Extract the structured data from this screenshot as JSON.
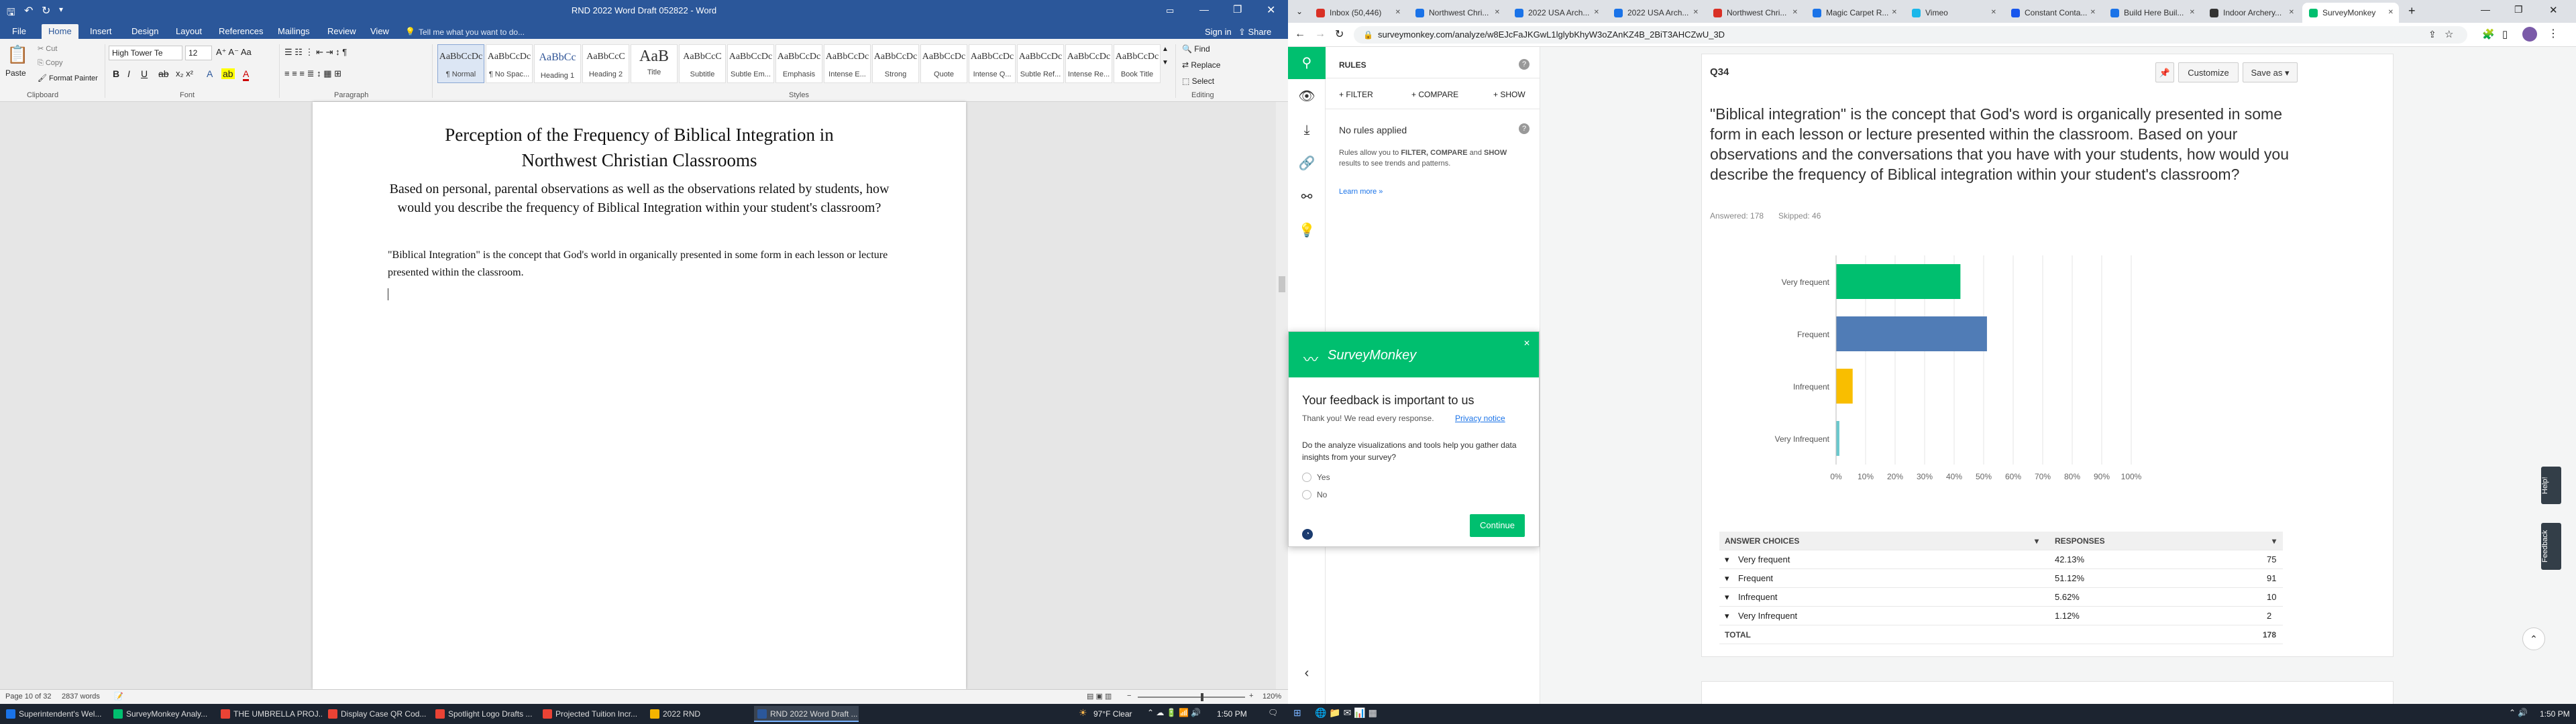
{
  "word": {
    "title": "RND 2022 Word Draft 052822 - Word",
    "signin": "Sign in",
    "share": "Share",
    "tabs": [
      "File",
      "Home",
      "Insert",
      "Design",
      "Layout",
      "References",
      "Mailings",
      "Review",
      "View"
    ],
    "tellme": "Tell me what you want to do...",
    "clipboard": {
      "paste": "Paste",
      "cut": "Cut",
      "copy": "Copy",
      "format_painter": "Format Painter",
      "label": "Clipboard"
    },
    "font": {
      "family": "High Tower Te",
      "size": "12",
      "label": "Font"
    },
    "paragraph_label": "Paragraph",
    "styles": [
      {
        "preview": "AaBbCcDc",
        "name": "¶ Normal"
      },
      {
        "preview": "AaBbCcDc",
        "name": "¶ No Spac..."
      },
      {
        "preview": "AaBbCc",
        "name": "Heading 1"
      },
      {
        "preview": "AaBbCcC",
        "name": "Heading 2"
      },
      {
        "preview": "AaB",
        "name": "Title"
      },
      {
        "preview": "AaBbCcC",
        "name": "Subtitle"
      },
      {
        "preview": "AaBbCcDc",
        "name": "Subtle Em..."
      },
      {
        "preview": "AaBbCcDc",
        "name": "Emphasis"
      },
      {
        "preview": "AaBbCcDc",
        "name": "Intense E..."
      },
      {
        "preview": "AaBbCcDc",
        "name": "Strong"
      },
      {
        "preview": "AaBbCcDc",
        "name": "Quote"
      },
      {
        "preview": "AaBbCcDc",
        "name": "Intense Q..."
      },
      {
        "preview": "AaBbCcDc",
        "name": "Subtle Ref..."
      },
      {
        "preview": "AaBbCcDc",
        "name": "Intense Re..."
      },
      {
        "preview": "AaBbCcDc",
        "name": "Book Title"
      }
    ],
    "styles_label": "Styles",
    "editing": {
      "find": "Find",
      "replace": "Replace",
      "select": "Select",
      "label": "Editing"
    },
    "doc": {
      "title_line1": "Perception of the Frequency of Biblical Integration in",
      "title_line2": "Northwest Christian Classrooms",
      "subtitle": "Based on personal, parental observations as well as the observations related by students, how would you describe the frequency of Biblical Integration within your student's classroom?",
      "body": "\"Biblical Integration\" is the concept that God's world in organically presented in some form in each lesson or lecture presented within the classroom."
    },
    "status": {
      "page": "Page 10 of 32",
      "words": "2837 words",
      "zoom": "120%"
    }
  },
  "chrome": {
    "tabs": [
      {
        "title": "Inbox (50,446)",
        "color": "#d93025"
      },
      {
        "title": "Northwest Chri...",
        "color": "#1a73e8"
      },
      {
        "title": "2022 USA Arch...",
        "color": "#1a73e8"
      },
      {
        "title": "2022 USA Arch...",
        "color": "#1a73e8"
      },
      {
        "title": "Northwest Chri...",
        "color": "#d93025"
      },
      {
        "title": "Magic Carpet R...",
        "color": "#1a73e8"
      },
      {
        "title": "Vimeo",
        "color": "#1ab7ea"
      },
      {
        "title": "Constant Conta...",
        "color": "#1856ed"
      },
      {
        "title": "Build Here Buil...",
        "color": "#1a73e8"
      },
      {
        "title": "Indoor Archery...",
        "color": "#333333"
      },
      {
        "title": "SurveyMonkey",
        "color": "#00bf6f"
      }
    ],
    "url": "surveymonkey.com/analyze/w8EJcFaJKGwL1lglybKhyW3oZAnKZ4B_2BiT3AHCZwU_3D"
  },
  "survey": {
    "rules": {
      "header": "RULES",
      "filter": "+ FILTER",
      "compare": "+ COMPARE",
      "show": "+ SHOW",
      "none": "No rules applied",
      "desc_a": "Rules allow you to ",
      "desc_b": "FILTER, COMPARE",
      "desc_c": " and ",
      "desc_d": "SHOW",
      "desc_e": " results to see trends and patterns.",
      "learn": "Learn more »"
    },
    "question": {
      "id": "Q34",
      "text": "\"Biblical integration\" is the concept that God's word is organically presented in some form in each lesson or lecture presented within the classroom. Based on your observations and the conversations that you have with your students, how would you describe the frequency of Biblical integration within your student's classroom?",
      "answered": "Answered: 178",
      "skipped": "Skipped: 46",
      "customize": "Customize",
      "save_as": "Save as"
    },
    "table": {
      "headers": [
        "ANSWER CHOICES",
        "RESPONSES"
      ],
      "rows": [
        {
          "choice": "Very frequent",
          "pct": "42.13%",
          "count": "75"
        },
        {
          "choice": "Frequent",
          "pct": "51.12%",
          "count": "91"
        },
        {
          "choice": "Infrequent",
          "pct": "5.62%",
          "count": "10"
        },
        {
          "choice": "Very Infrequent",
          "pct": "1.12%",
          "count": "2"
        }
      ],
      "total_label": "TOTAL",
      "total": "178"
    },
    "popup": {
      "brand": "SurveyMonkey",
      "heading": "Your feedback is important to us",
      "thanks": "Thank you! We read every response.",
      "privacy": "Privacy notice",
      "question": "Do the analyze visualizations and tools help you gather data insights from your survey?",
      "yes": "Yes",
      "no": "No",
      "continue": "Continue"
    },
    "side_tabs": [
      "Help!",
      "Feedback"
    ]
  },
  "chart_data": {
    "type": "bar",
    "orientation": "horizontal",
    "categories": [
      "Very frequent",
      "Frequent",
      "Infrequent",
      "Very Infrequent"
    ],
    "values": [
      42.13,
      51.12,
      5.62,
      1.12
    ],
    "colors": [
      "#00bf6f",
      "#507cb6",
      "#f9be00",
      "#6bc8cd"
    ],
    "xlim": [
      0,
      100
    ],
    "xticks": [
      "0%",
      "10%",
      "20%",
      "30%",
      "40%",
      "50%",
      "60%",
      "70%",
      "80%",
      "90%",
      "100%"
    ],
    "grid": true
  },
  "taskbar": {
    "apps": [
      {
        "title": "Superintendent's Wel...",
        "color": "#1a73e8"
      },
      {
        "title": "SurveyMonkey Analy...",
        "color": "#00bf6f"
      },
      {
        "title": "THE UMBRELLA PROJ...",
        "color": "#ea4335"
      },
      {
        "title": "Display Case QR Cod...",
        "color": "#ea4335"
      },
      {
        "title": "Spotlight Logo Drafts ...",
        "color": "#ea4335"
      },
      {
        "title": "Projected Tuition Incr...",
        "color": "#ea4335"
      },
      {
        "title": "2022 RND",
        "color": "#f4b400"
      },
      {
        "title": "RND 2022 Word Draft ...",
        "color": "#2b579a"
      }
    ],
    "weather": "97°F Clear",
    "time_left": "1:50 PM",
    "time_right": "1:50 PM"
  }
}
